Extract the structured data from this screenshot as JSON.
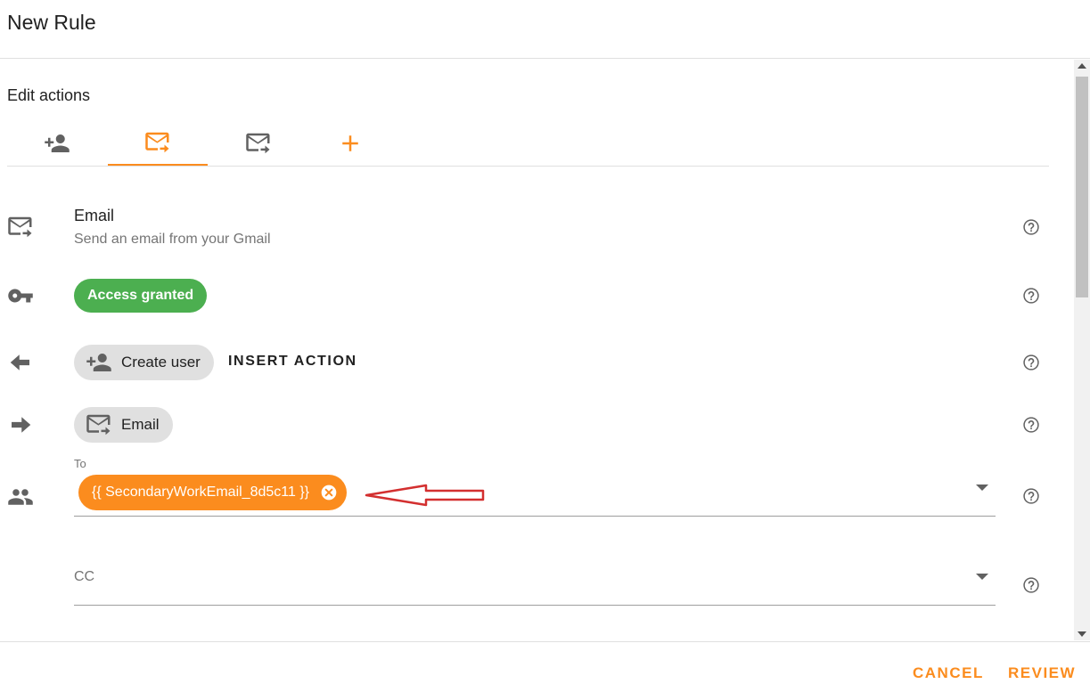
{
  "window": {
    "title": "New Rule"
  },
  "editor": {
    "section_title": "Edit actions",
    "tabs": [
      {
        "icon": "add-user-icon",
        "active": false
      },
      {
        "icon": "forward-email-icon",
        "active": true
      },
      {
        "icon": "forward-email-icon",
        "active": false
      },
      {
        "icon": "plus-icon",
        "active": false
      }
    ]
  },
  "action": {
    "icon": "forward-email-icon",
    "title": "Email",
    "subtitle": "Send an email from your Gmail"
  },
  "access": {
    "icon": "key-icon",
    "label": "Access granted",
    "color": "#4caf50"
  },
  "previous": {
    "icon": "arrow-left-icon",
    "chip_label": "Create user",
    "insert_label": "INSERT ACTION"
  },
  "next": {
    "icon": "arrow-right-icon",
    "chip_label": "Email"
  },
  "to_field": {
    "icon": "people-icon",
    "label": "To",
    "chip_value": "{{ SecondaryWorkEmail_8d5c11 }}"
  },
  "cc_field": {
    "placeholder": "CC"
  },
  "footer": {
    "cancel_label": "CANCEL",
    "review_label": "REVIEW"
  },
  "colors": {
    "accent": "#fb8c1e",
    "annotation": "#d32f2f",
    "icon": "#616161"
  }
}
